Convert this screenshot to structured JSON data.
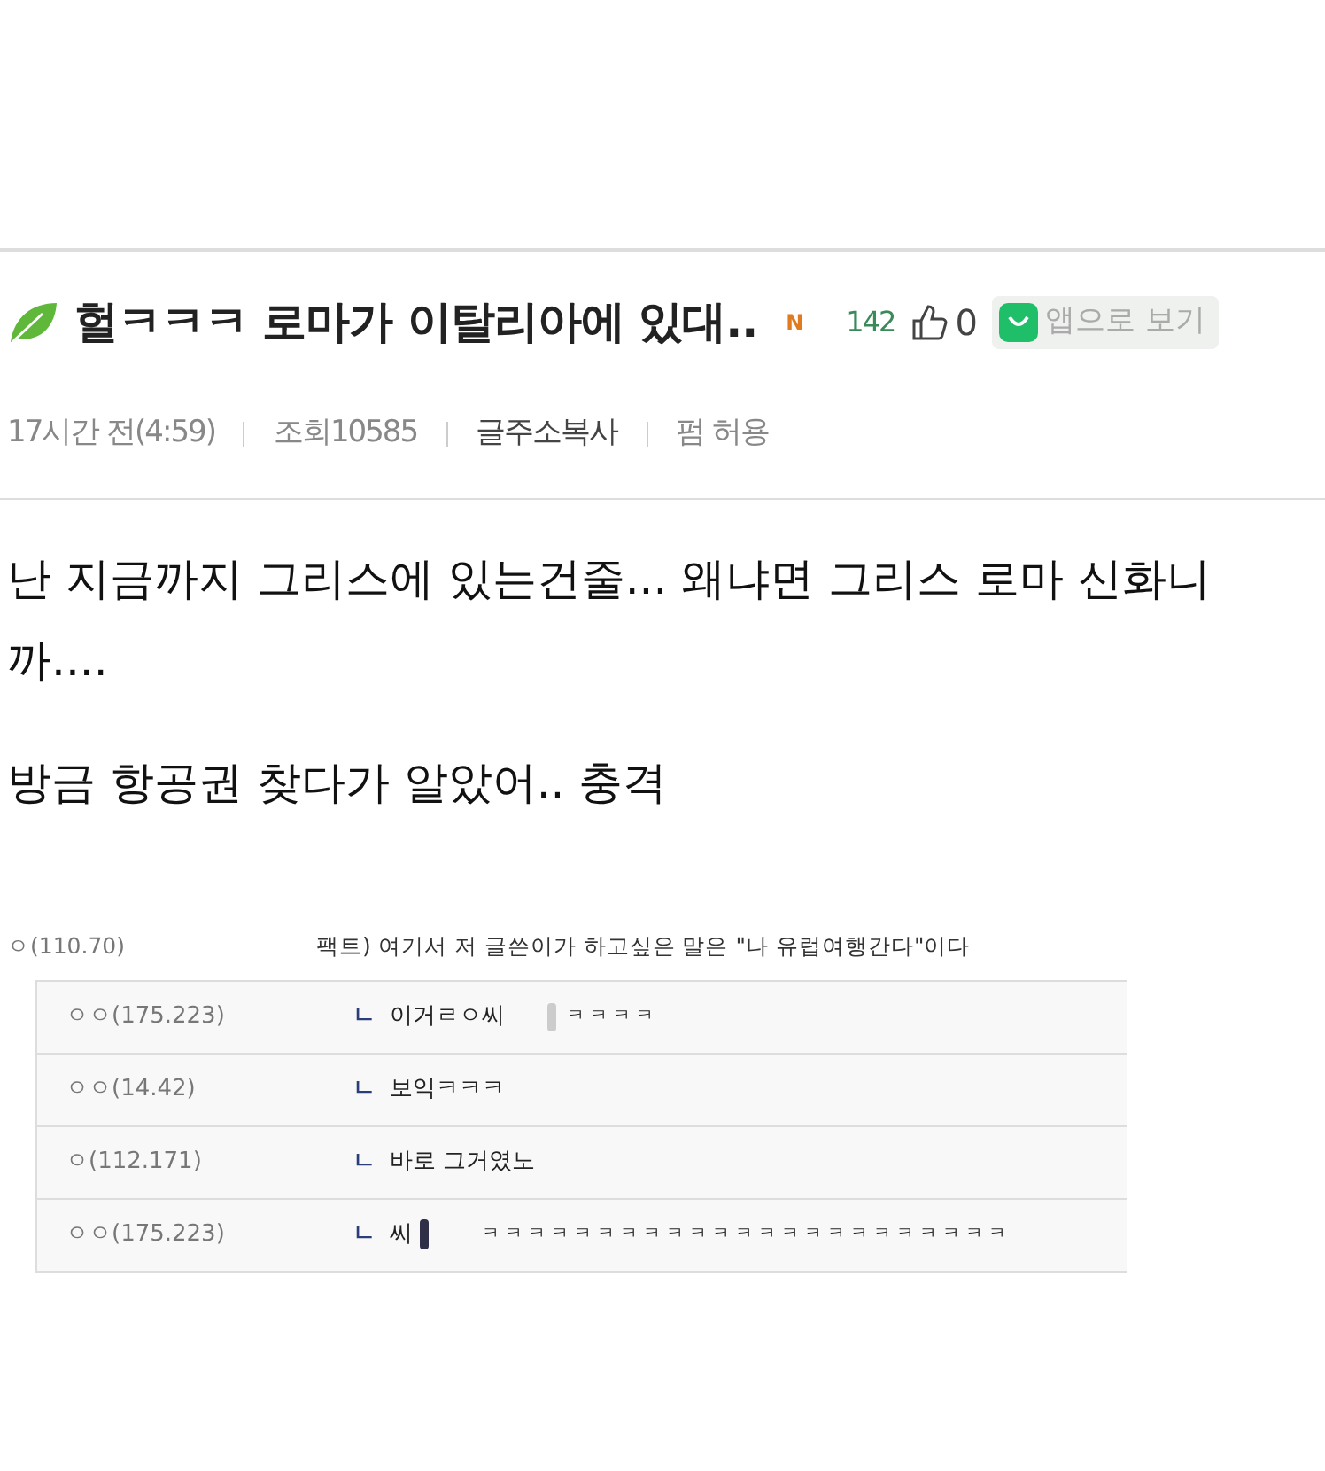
{
  "post": {
    "title": "헐ㅋㅋㅋ 로마가 이탈리아에 있대..",
    "new_badge": "N",
    "count": "142",
    "likes": "0",
    "app_button": "앱으로 보기"
  },
  "meta": [
    {
      "kind": "text",
      "text": "17시간 전(4:59)"
    },
    {
      "kind": "text",
      "text": "조회10585"
    },
    {
      "kind": "link",
      "text": "글주소복사"
    },
    {
      "kind": "text",
      "text": "펌 허용"
    }
  ],
  "body": [
    "난 지금까지 그리스에 있는건줄... 왜냐면 그리스 로마 신화니까....",
    "방금 항공권 찾다가 알았어.. 충격"
  ],
  "comment": {
    "author": "ㅇ(110.70)",
    "text": "팩트) 여기서 저 글쓴이가 하고싶은 말은 \"나 유럽여행간다\"이다"
  },
  "replies": [
    {
      "author": "ㅇㅇ(175.223)",
      "marker": "ㄴ",
      "text": "이거ㄹㅇ씨",
      "kind": "light",
      "rest": "ㅋㅋㅋㅋ"
    },
    {
      "author": "ㅇㅇ(14.42)",
      "marker": "ㄴ",
      "text": "보익ㅋㅋㅋ"
    },
    {
      "author": "ㅇ(112.171)",
      "marker": "ㄴ",
      "text": "바로 그거였노"
    },
    {
      "author": "ㅇㅇ(175.223)",
      "marker": "ㄴ",
      "text": "씨",
      "kind": "dark",
      "rest": "ㅋㅋㅋㅋㅋㅋㅋㅋㅋㅋㅋㅋㅋㅋㅋㅋㅋㅋㅋㅋㅋㅋㅋ"
    }
  ]
}
